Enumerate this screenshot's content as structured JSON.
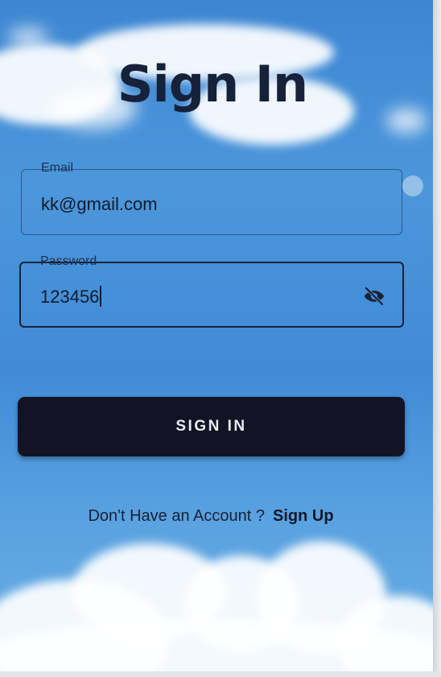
{
  "screen": {
    "title": "Sign In"
  },
  "email_field": {
    "label": "Email",
    "value": "kk@gmail.com"
  },
  "password_field": {
    "label": "Password",
    "value": "123456",
    "visibility_icon": "eye-off-icon"
  },
  "signin_button": {
    "label": "SIGN IN"
  },
  "footer": {
    "prompt": "Don't Have an Account ?",
    "link": "Sign Up"
  },
  "colors": {
    "sky": "#4c97db",
    "button": "#121426",
    "text_dark": "#16223a"
  }
}
